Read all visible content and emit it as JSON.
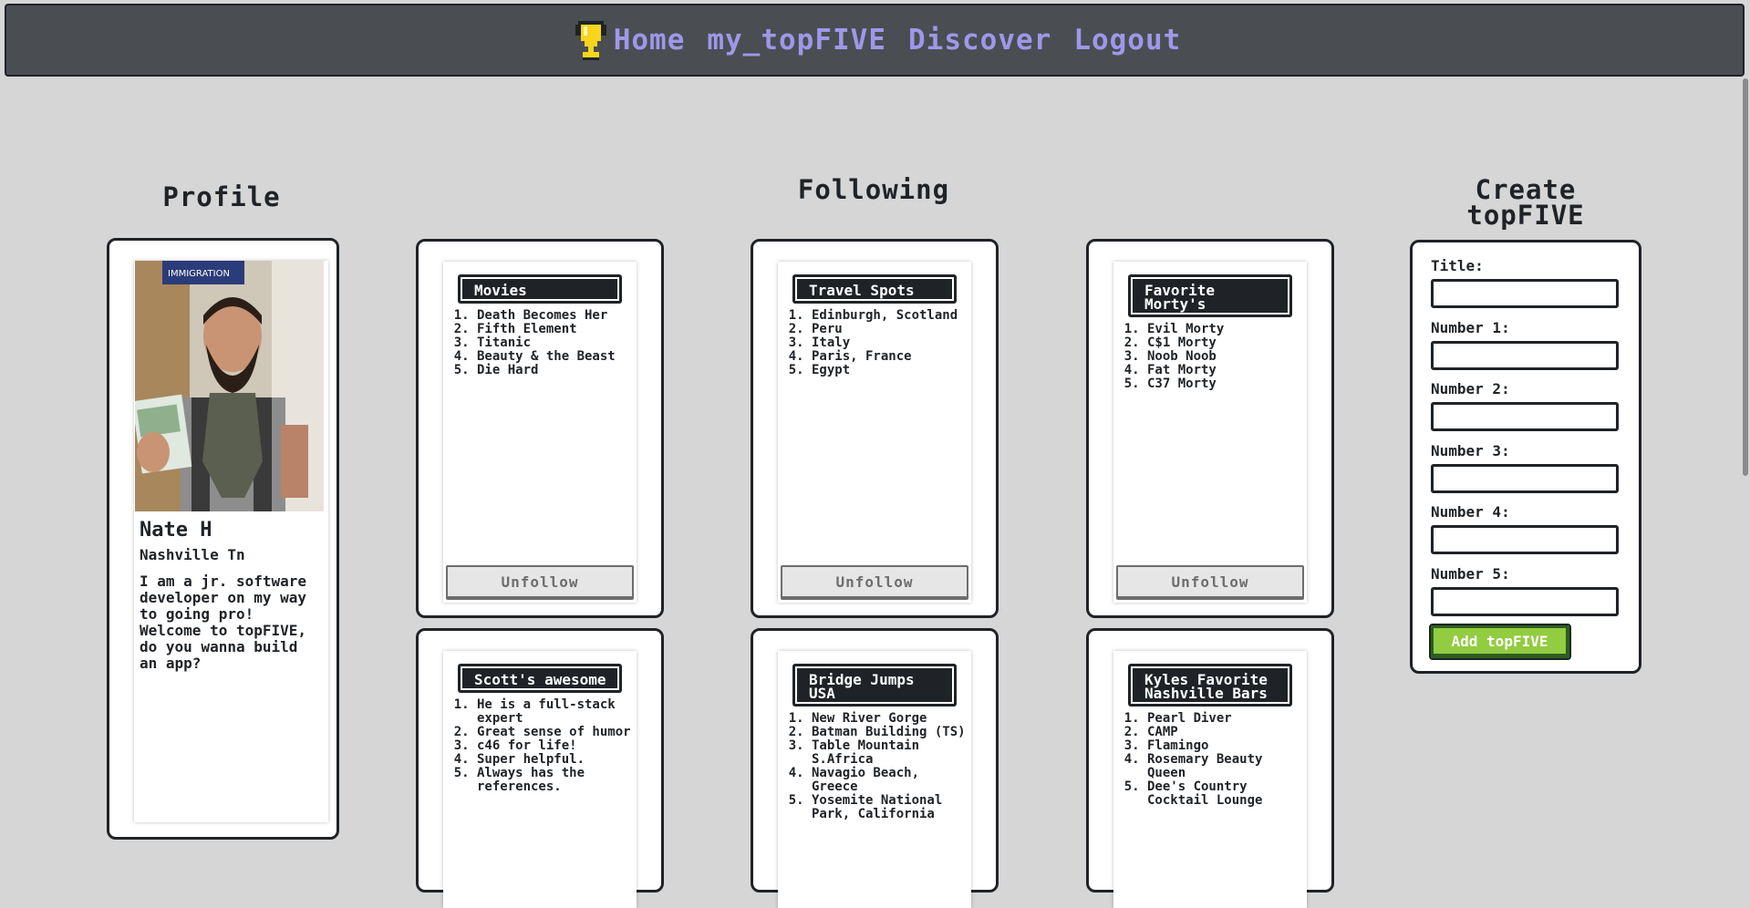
{
  "nav": {
    "links": [
      "Home",
      "my_topFIVE",
      "Discover",
      "Logout"
    ]
  },
  "headings": {
    "profile": "Profile",
    "following": "Following",
    "create_line1": "Create",
    "create_line2": "topFIVE"
  },
  "profile": {
    "name": "Nate H",
    "location": "Nashville Tn",
    "bio": "I am a jr. software developer on my way to going pro! Welcome to topFIVE, do you wanna build an app?"
  },
  "following": {
    "unfollow_label": "Unfollow",
    "lists": [
      {
        "title": "Movies",
        "items": [
          "Death Becomes Her",
          "Fifth Element",
          "Titanic",
          "Beauty & the Beast",
          "Die Hard"
        ]
      },
      {
        "title": "Travel Spots",
        "items": [
          "Edinburgh, Scotland",
          "Peru",
          "Italy",
          "Paris, France",
          "Egypt"
        ]
      },
      {
        "title": "Favorite Morty's",
        "items": [
          "Evil Morty",
          "C$1 Morty",
          "Noob Noob",
          "Fat Morty",
          "C37 Morty"
        ]
      },
      {
        "title": "Scott's awesome",
        "items": [
          "He is a full-stack expert",
          "Great sense of humor",
          "c46 for life!",
          "Super helpful.",
          "Always has the references."
        ]
      },
      {
        "title": "Bridge Jumps USA",
        "items": [
          "New River Gorge",
          "Batman Building (TS)",
          "Table Mountain S.Africa",
          "Navagio Beach, Greece",
          "Yosemite National Park, California"
        ]
      },
      {
        "title": "Kyles Favorite Nashville Bars",
        "items": [
          "Pearl Diver",
          "CAMP",
          "Flamingo",
          "Rosemary Beauty Queen",
          "Dee's Country Cocktail Lounge"
        ]
      }
    ]
  },
  "create_form": {
    "labels": [
      "Title:",
      "Number 1:",
      "Number 2:",
      "Number 3:",
      "Number 4:",
      "Number 5:"
    ],
    "values": [
      "",
      "",
      "",
      "",
      "",
      ""
    ],
    "submit_label": "Add topFIVE"
  },
  "colors": {
    "background": "#d6d6d6",
    "navbar": "#4a4e52",
    "nav_link": "#9f97ea",
    "dark": "#1f2327",
    "submit": "#92cc41",
    "trophy": "#f7d51d"
  },
  "icons": {
    "logo": "trophy-icon"
  }
}
